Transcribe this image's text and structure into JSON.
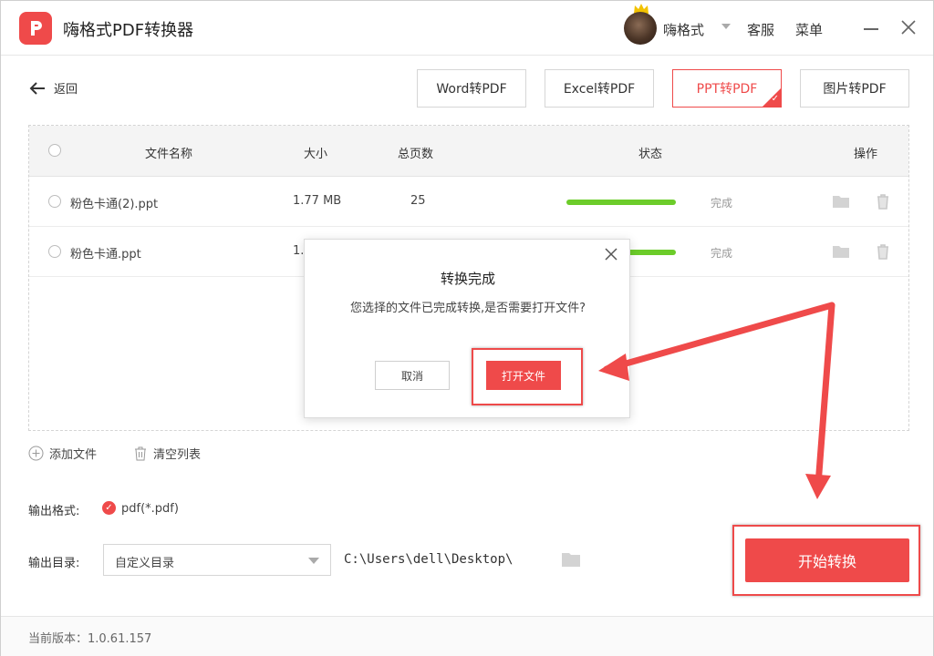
{
  "app": {
    "title": "嗨格式PDF转换器",
    "username": "嗨格式",
    "service": "客服",
    "menu": "菜单"
  },
  "nav": {
    "back": "返回"
  },
  "tabs": [
    {
      "label": "Word转PDF",
      "active": false
    },
    {
      "label": "Excel转PDF",
      "active": false
    },
    {
      "label": "PPT转PDF",
      "active": true
    },
    {
      "label": "图片转PDF",
      "active": false
    }
  ],
  "table": {
    "headers": {
      "name": "文件名称",
      "size": "大小",
      "pages": "总页数",
      "status": "状态",
      "actions": "操作"
    },
    "rows": [
      {
        "name": "粉色卡通(2).ppt",
        "size": "1.77 MB",
        "pages": "25",
        "status": "完成",
        "progress": 1.0
      },
      {
        "name": "粉色卡通.ppt",
        "size": "1.7",
        "pages": "",
        "status": "完成",
        "progress": 1.0
      }
    ]
  },
  "actions": {
    "add_file": "添加文件",
    "clear_list": "清空列表"
  },
  "output": {
    "format_label": "输出格式:",
    "format_value": "pdf(*.pdf)",
    "dir_label": "输出目录:",
    "dir_select": "自定义目录",
    "dir_path": "C:\\Users\\dell\\Desktop\\"
  },
  "start_button": "开始转换",
  "footer": {
    "version": "当前版本：1.0.61.157"
  },
  "dialog": {
    "title": "转换完成",
    "message": "您选择的文件已完成转换,是否需要打开文件?",
    "cancel": "取消",
    "open": "打开文件"
  },
  "colors": {
    "accent": "#ef4a4a",
    "progress": "#6ccc2a",
    "annotation": "#ee4a4a"
  }
}
